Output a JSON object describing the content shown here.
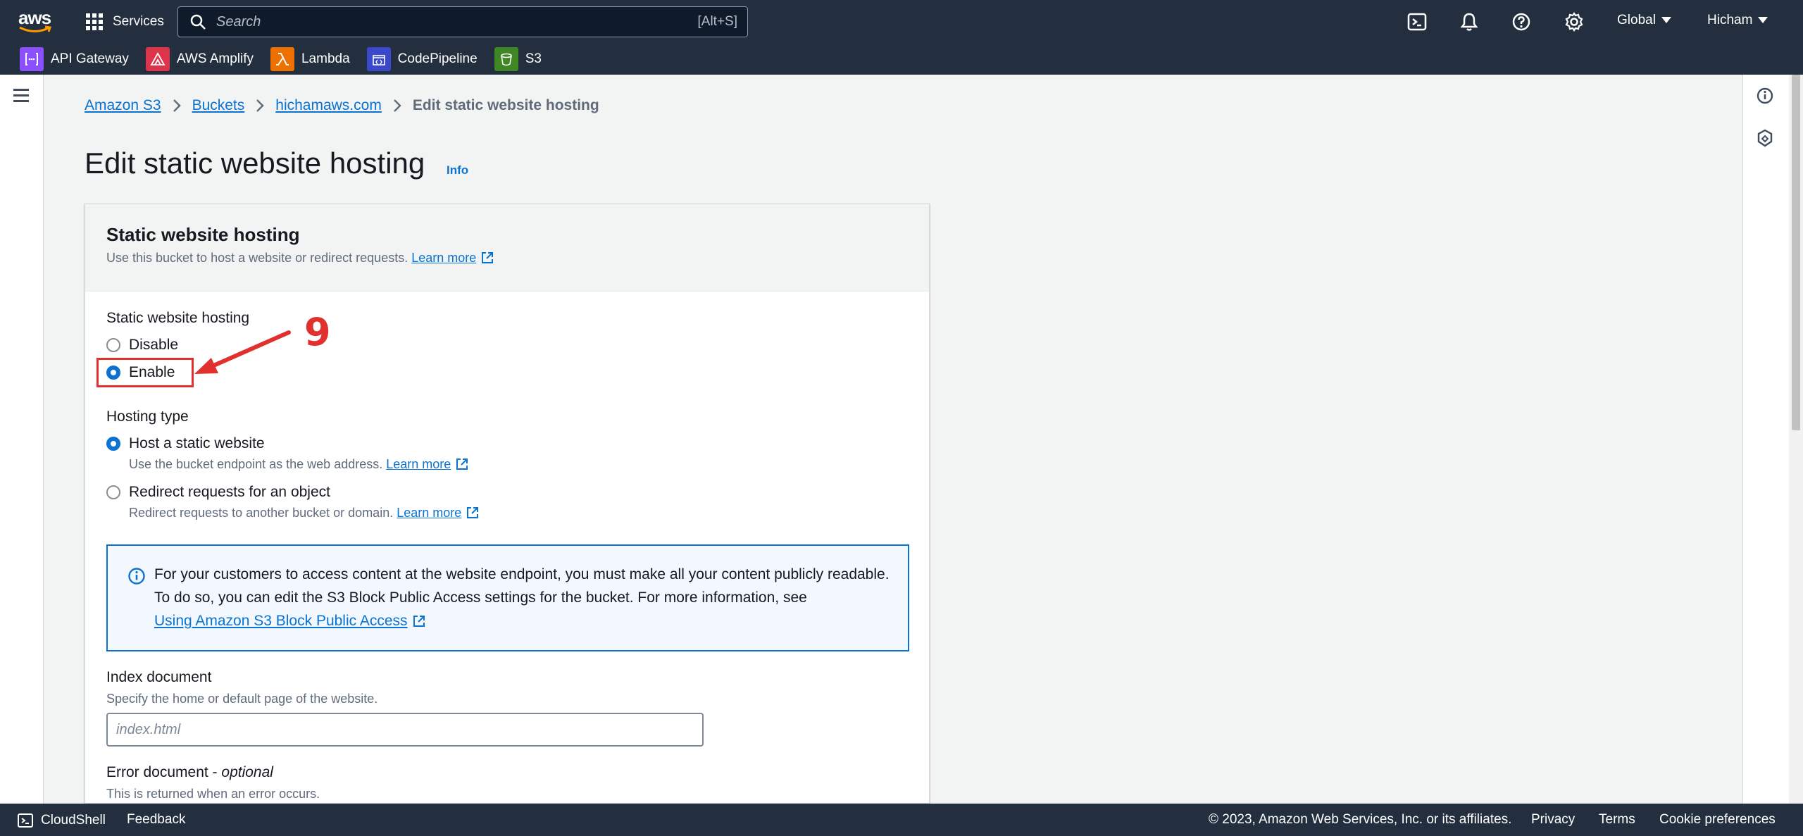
{
  "topnav": {
    "logo_text": "aws",
    "services_label": "Services",
    "search_placeholder": "Search",
    "search_shortcut": "[Alt+S]",
    "region_label": "Global",
    "user_label": "Hicham",
    "icons": [
      "cloudshell-icon",
      "bell-icon",
      "help-icon",
      "gear-icon"
    ]
  },
  "favorites": [
    {
      "label": "API Gateway",
      "color": "#8c4fff"
    },
    {
      "label": "AWS Amplify",
      "color": "#dd344c"
    },
    {
      "label": "Lambda",
      "color": "#ed7100"
    },
    {
      "label": "CodePipeline",
      "color": "#3b48cc"
    },
    {
      "label": "S3",
      "color": "#3f8624"
    }
  ],
  "breadcrumb": {
    "items": [
      "Amazon S3",
      "Buckets",
      "hichamaws.com"
    ],
    "current": "Edit static website hosting"
  },
  "page": {
    "title": "Edit static website hosting",
    "info_link": "Info"
  },
  "panel": {
    "title": "Static website hosting",
    "description": "Use this bucket to host a website or redirect requests.",
    "learn_more": "Learn more",
    "hosting_label": "Static website hosting",
    "hosting_options": [
      "Disable",
      "Enable"
    ],
    "hosting_selected": "Enable",
    "hosting_type_label": "Hosting type",
    "hosting_type_options": [
      {
        "label": "Host a static website",
        "desc": "Use the bucket endpoint as the web address."
      },
      {
        "label": "Redirect requests for an object",
        "desc": "Redirect requests to another bucket or domain."
      }
    ],
    "hosting_type_selected": "Host a static website",
    "alert_text": "For your customers to access content at the website endpoint, you must make all your content publicly readable. To do so, you can edit the S3 Block Public Access settings for the bucket. For more information, see",
    "alert_link": "Using Amazon S3 Block Public Access",
    "index_label": "Index document",
    "index_desc": "Specify the home or default page of the website.",
    "index_placeholder": "index.html",
    "error_label": "Error document - ",
    "error_optional": "optional",
    "error_desc": "This is returned when an error occurs."
  },
  "annotation": {
    "step_number": "9",
    "color": "#e0312f"
  },
  "footer": {
    "cloudshell": "CloudShell",
    "feedback": "Feedback",
    "copyright": "© 2023, Amazon Web Services, Inc. or its affiliates.",
    "privacy": "Privacy",
    "terms": "Terms",
    "cookie": "Cookie preferences"
  },
  "colors": {
    "nav_bg": "#232f3e",
    "link": "#0972d3",
    "accent": "#0972d3"
  }
}
